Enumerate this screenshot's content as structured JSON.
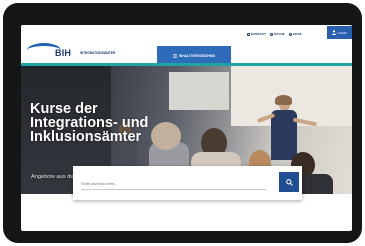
{
  "header": {
    "logo_text": "BIH",
    "logo_subtitle": "INTEGRATIONSÄMTER",
    "links": [
      {
        "label": "KONTAKT",
        "icon": "envelope-icon"
      },
      {
        "label": "SUCHE",
        "icon": "search-icon"
      },
      {
        "label": "HILFE",
        "icon": "help-icon"
      }
    ],
    "login_label": "LOGIN",
    "menu_label": "INHALTSVERZEICHNIS",
    "accent_color": "#2e6bb8",
    "divider_color": "#1fa3a3"
  },
  "hero": {
    "title_lines": [
      "Kurse der",
      "Integrations- und",
      "Inklusionsämter"
    ],
    "subtitle": "Angebote aus den Integrationsämtern"
  },
  "search": {
    "placeholder": "Seite durchsuchen..."
  }
}
